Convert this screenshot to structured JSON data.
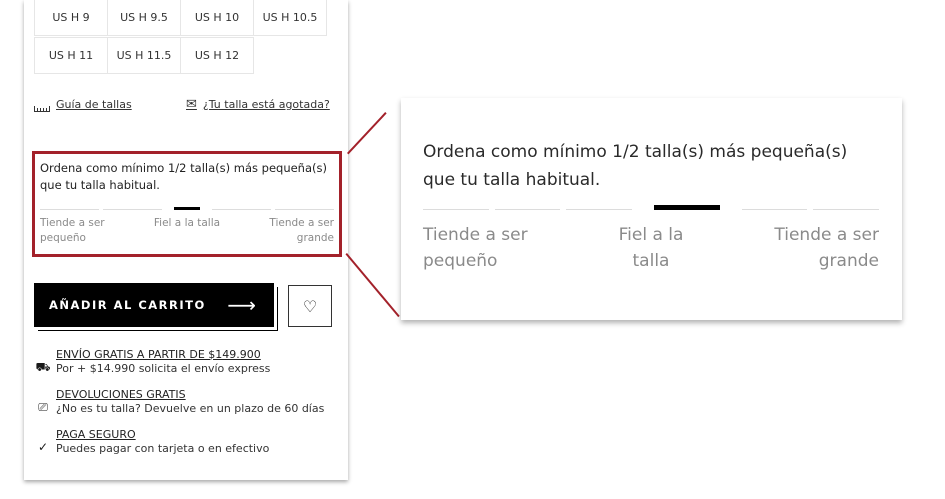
{
  "sizes": {
    "rows": [
      [
        "US H 9",
        "US H 9.5",
        "US H 10",
        "US H 10.5"
      ],
      [
        "US H 11",
        "US H 11.5",
        "US H 12"
      ]
    ]
  },
  "links": {
    "size_guide": "Guía de tallas",
    "sold_out": "¿Tu talla está agotada?"
  },
  "fit": {
    "message": "Ordena como mínimo 1/2 talla(s) más pequeña(s) que tu talla habitual.",
    "label_left": "Tiende a ser pequeño",
    "label_center": "Fiel a la talla",
    "label_right": "Tiende a ser grande"
  },
  "cart": {
    "label": "AÑADIR AL CARRITO",
    "arrow": "⟶"
  },
  "wishlist": {
    "icon": "heart-icon"
  },
  "benefits": [
    {
      "title": "ENVÍO GRATIS A PARTIR DE $149.900",
      "desc": "Por + $14.990 solicita el envío express",
      "icon": "truck-icon"
    },
    {
      "title": "DEVOLUCIONES GRATIS",
      "desc": "¿No es tu talla? Devuelve en un plazo de 60 días",
      "icon": "return-icon"
    },
    {
      "title": "PAGA SEGURO",
      "desc": "Puedes pagar con tarjeta o en efectivo",
      "icon": "check-icon"
    }
  ],
  "colors": {
    "highlight": "#a3212a",
    "button": "#000000"
  }
}
